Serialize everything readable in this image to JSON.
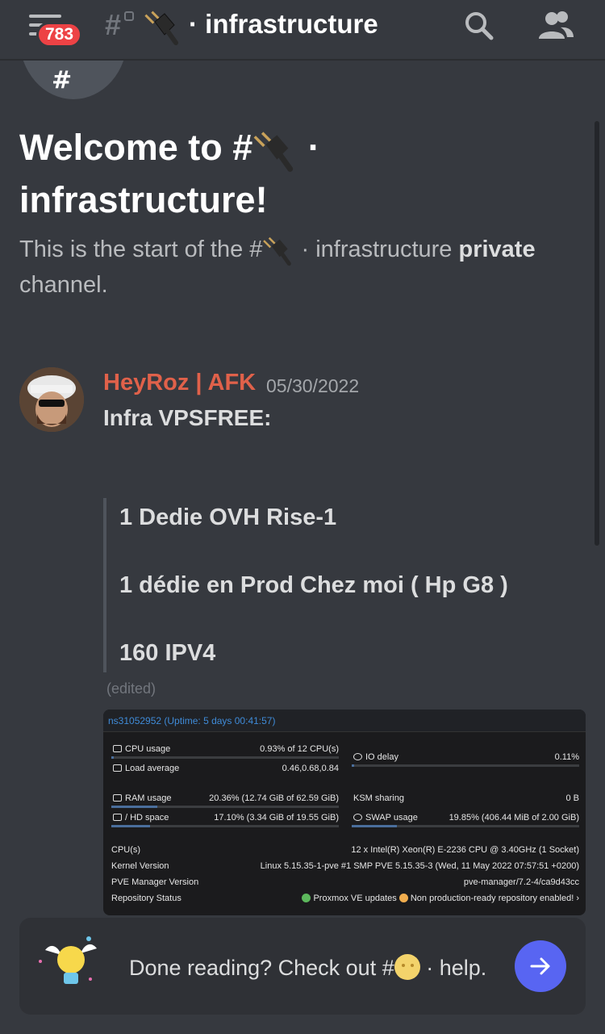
{
  "header": {
    "badge_count": "783",
    "channel_name": "· infrastructure"
  },
  "welcome": {
    "line1_prefix": "Welcome to #",
    "line1_suffix": " ·",
    "line2": "infrastructure!",
    "intro_prefix": "This is the start of the #",
    "intro_middle": " · infrastructure ",
    "intro_bold": "private",
    "intro_suffix": "channel."
  },
  "message": {
    "author": "HeyRoz | AFK",
    "timestamp": "05/30/2022",
    "title": "Infra VPSFREE:",
    "quote_lines": [
      "1 Dedie OVH Rise-1",
      "1 dédie en Prod Chez moi ( Hp G8 )",
      "160 IPV4"
    ],
    "edited": "(edited)"
  },
  "pve": {
    "title": "ns31052952 (Uptime: 5 days 00:41:57)",
    "cpu_label": "CPU usage",
    "cpu_value": "0.93% of 12 CPU(s)",
    "cpu_fraction": 0.0093,
    "load_label": "Load average",
    "load_value": "0.46,0.68,0.84",
    "io_label": "IO delay",
    "io_value": "0.11%",
    "io_fraction": 0.0011,
    "ram_label": "RAM usage",
    "ram_value": "20.36% (12.74 GiB of 62.59 GiB)",
    "ram_fraction": 0.2036,
    "ksm_label": "KSM sharing",
    "ksm_value": "0 B",
    "hd_label": "/ HD space",
    "hd_value": "17.10% (3.34 GiB of 19.55 GiB)",
    "hd_fraction": 0.171,
    "swap_label": "SWAP usage",
    "swap_value": "19.85% (406.44 MiB of 2.00 GiB)",
    "swap_fraction": 0.1985,
    "cpus_label": "CPU(s)",
    "cpus_value": "12 x Intel(R) Xeon(R) E-2236 CPU @ 3.40GHz (1 Socket)",
    "kernel_label": "Kernel Version",
    "kernel_value": "Linux 5.15.35-1-pve #1 SMP PVE 5.15.35-3 (Wed, 11 May 2022 07:57:51 +0200)",
    "manager_label": "PVE Manager Version",
    "manager_value": "pve-manager/7.2-4/ca9d43cc",
    "repo_label": "Repository Status",
    "repo_updates": "Proxmox VE updates",
    "repo_warning": "Non production-ready repository enabled!"
  },
  "banner": {
    "text_prefix": "Done reading? Check out #",
    "text_suffix": " · help."
  },
  "colors": {
    "accent": "#5865f2",
    "author": "#e0614a",
    "badge": "#ed4245"
  }
}
